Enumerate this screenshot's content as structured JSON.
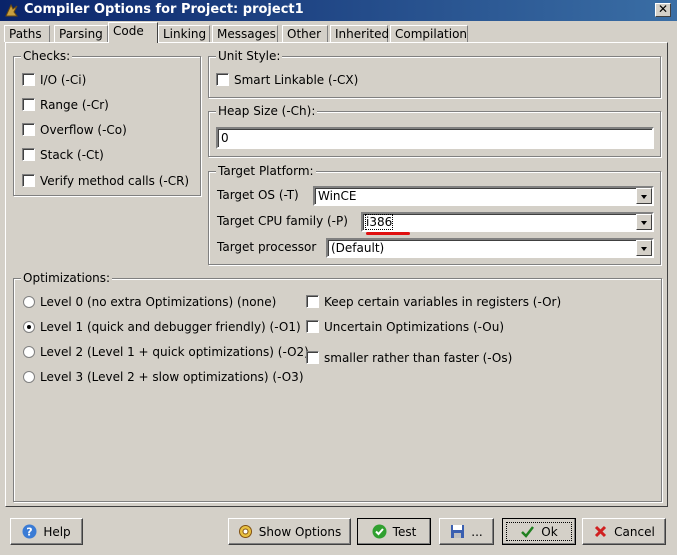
{
  "window": {
    "title": "Compiler Options for Project: project1"
  },
  "tabs": [
    {
      "label": "Paths"
    },
    {
      "label": "Parsing"
    },
    {
      "label": "Code"
    },
    {
      "label": "Linking"
    },
    {
      "label": "Messages"
    },
    {
      "label": "Other"
    },
    {
      "label": "Inherited"
    },
    {
      "label": "Compilation"
    }
  ],
  "active_tab": "Code",
  "checks": {
    "title": "Checks:",
    "items": [
      {
        "label": "I/O (-Ci)",
        "checked": false
      },
      {
        "label": "Range (-Cr)",
        "checked": false
      },
      {
        "label": "Overflow (-Co)",
        "checked": false
      },
      {
        "label": "Stack (-Ct)",
        "checked": false
      },
      {
        "label": "Verify method calls (-CR)",
        "checked": false
      }
    ]
  },
  "unit_style": {
    "title": "Unit Style:",
    "smart_linkable": {
      "label": "Smart Linkable (-CX)",
      "checked": false
    }
  },
  "heap_size": {
    "title": "Heap Size (-Ch):",
    "value": "0"
  },
  "target_platform": {
    "title": "Target Platform:",
    "os_label": "Target OS (-T)",
    "os_value": "WinCE",
    "cpu_label": "Target CPU family (-P)",
    "cpu_value": "i386",
    "processor_label": "Target processor",
    "processor_value": "(Default)"
  },
  "optimizations": {
    "title": "Optimizations:",
    "levels": [
      {
        "label": "Level 0 (no extra Optimizations) (none)",
        "selected": false
      },
      {
        "label": "Level 1 (quick and debugger friendly) (-O1)",
        "selected": true
      },
      {
        "label": "Level 2 (Level 1 + quick optimizations) (-O2)",
        "selected": false
      },
      {
        "label": "Level 3 (Level 2 + slow optimizations) (-O3)",
        "selected": false
      }
    ],
    "options": [
      {
        "label": "Keep certain variables in registers (-Or)",
        "checked": false
      },
      {
        "label": "Uncertain Optimizations (-Ou)",
        "checked": false
      },
      {
        "label": "smaller rather than faster (-Os)",
        "checked": false
      }
    ]
  },
  "buttons": {
    "help": "Help",
    "show_options": "Show Options",
    "test": "Test",
    "save": "...",
    "ok": "Ok",
    "cancel": "Cancel"
  },
  "colors": {
    "annotation_underline": "#e01010",
    "title_bar": "#0a246a"
  }
}
